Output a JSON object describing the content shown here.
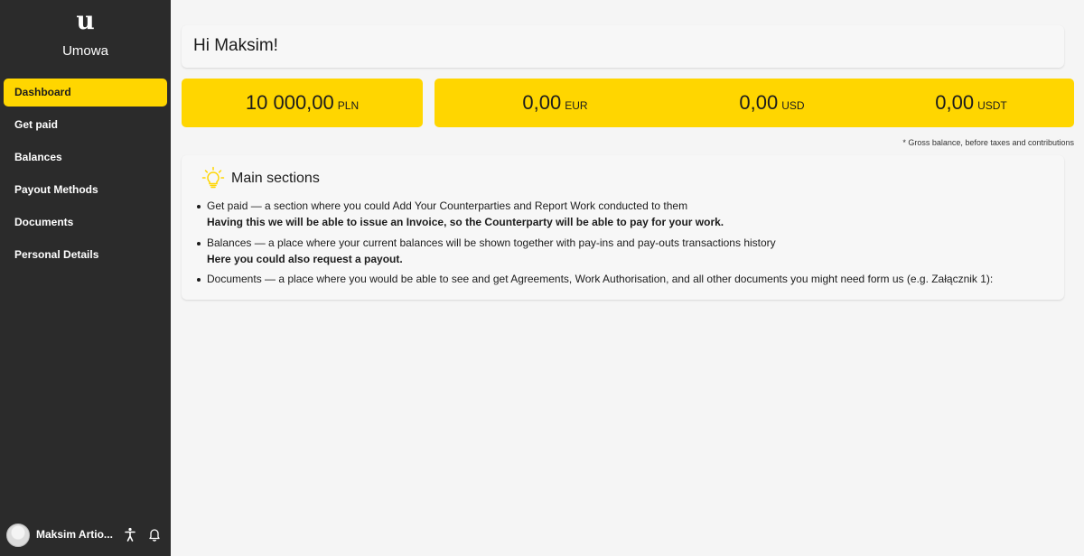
{
  "app": {
    "logo_letter": "u",
    "brand_name": "Umowa"
  },
  "sidebar": {
    "items": [
      {
        "label": "Dashboard",
        "active": true
      },
      {
        "label": "Get paid"
      },
      {
        "label": "Balances"
      },
      {
        "label": "Payout Methods"
      },
      {
        "label": "Documents"
      },
      {
        "label": "Personal Details"
      }
    ],
    "user": {
      "name": "Maksim Artio...",
      "accessibility_icon": "accessibility-icon",
      "notification_icon": "bell-icon"
    }
  },
  "header": {
    "greeting": "Hi Maksim!"
  },
  "balances": [
    {
      "amount": "10 000,00",
      "currency": "PLN"
    },
    {
      "amount": "0,00",
      "currency": "EUR"
    },
    {
      "amount": "0,00",
      "currency": "USD"
    },
    {
      "amount": "0,00",
      "currency": "USDT"
    }
  ],
  "balances_note": "* Gross balance, before taxes and contributions",
  "sections": {
    "icon": "lightbulb-icon",
    "title": "Main sections",
    "items": [
      {
        "text": "Get paid — a section where you could Add Your Counterparties and Report Work conducted to them",
        "bold": "Having this we will be able to issue an Invoice, so the Counterparty will be able to pay for your work."
      },
      {
        "text": "Balances — a place where your current balances will be shown together with pay-ins and pay-outs transactions history",
        "bold": "Here you could also request a payout."
      },
      {
        "text": "Documents — a place where you would be able to see and get Agreements, Work Authorisation, and all other documents you might need form us (e.g. Załącznik 1):"
      }
    ]
  },
  "colors": {
    "accent": "#ffd600",
    "sidebar_bg": "#2b2b2b",
    "page_bg": "#f5f5f5"
  }
}
